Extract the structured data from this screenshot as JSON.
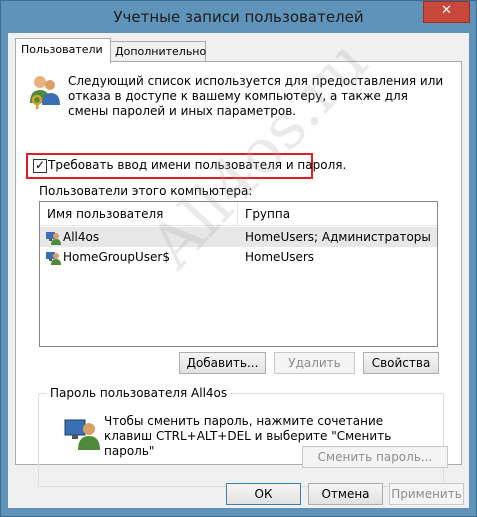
{
  "window": {
    "title": "Учетные записи пользователей",
    "close_label": "✕"
  },
  "tabs": [
    {
      "label": "Пользователи",
      "active": true
    },
    {
      "label": "Дополнительно",
      "active": false
    }
  ],
  "intro_text": "Следующий список используется для предоставления или отказа в доступе к вашему компьютеру, а также для смены паролей и иных параметров.",
  "require_login": {
    "label": "Требовать ввод имени пользователя и пароля.",
    "checked": true
  },
  "users_label": "Пользователи этого компьютера:",
  "users_table": {
    "columns": [
      "Имя пользователя",
      "Группа"
    ],
    "rows": [
      {
        "name": "All4os",
        "group": "HomeUsers; Администраторы",
        "selected": true
      },
      {
        "name": "HomeGroupUser$",
        "group": "HomeUsers",
        "selected": false
      }
    ]
  },
  "user_buttons": {
    "add": "Добавить...",
    "remove": "Удалить",
    "properties": "Свойства"
  },
  "password_group": {
    "title": "Пароль пользователя All4os",
    "text": "Чтобы сменить пароль, нажмите сочетание клавиш CTRL+ALT+DEL и выберите \"Сменить пароль\"",
    "button": "Сменить пароль..."
  },
  "dialog_buttons": {
    "ok": "ОК",
    "cancel": "Отмена",
    "apply": "Применить"
  },
  "watermark": "All4os.ru",
  "colors": {
    "titlebar": "#5f93b9",
    "close": "#c7473b",
    "highlight_box": "#e21e25"
  }
}
